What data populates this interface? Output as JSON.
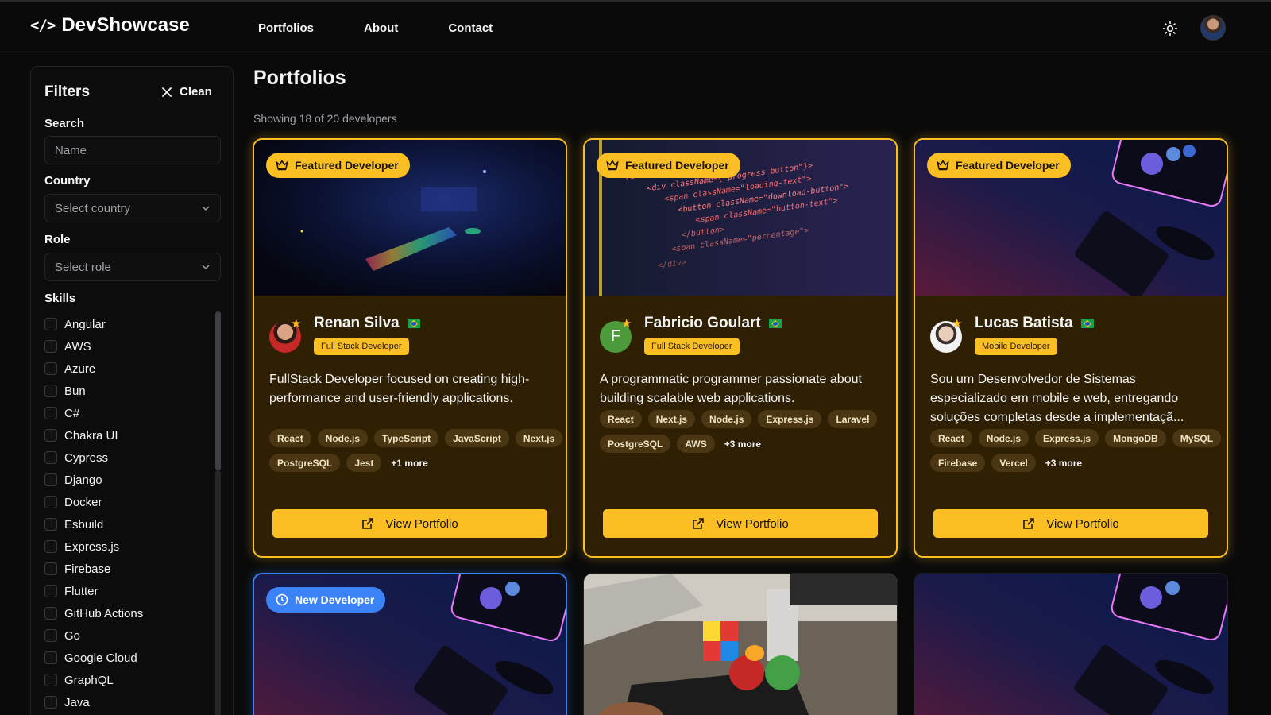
{
  "header": {
    "brand_icon": "</>",
    "brand": "DevShowcase",
    "nav": [
      "Portfolios",
      "About",
      "Contact"
    ],
    "theme_icon": "sun-icon",
    "avatar_icon": "user-avatar"
  },
  "filters": {
    "title": "Filters",
    "clean_label": "Clean",
    "search_label": "Search",
    "search_placeholder": "Name",
    "country_label": "Country",
    "country_value": "Select country",
    "role_label": "Role",
    "role_value": "Select role",
    "skills_label": "Skills",
    "skills": [
      "Angular",
      "AWS",
      "Azure",
      "Bun",
      "C#",
      "Chakra UI",
      "Cypress",
      "Django",
      "Docker",
      "Esbuild",
      "Express.js",
      "Firebase",
      "Flutter",
      "GitHub Actions",
      "Go",
      "Google Cloud",
      "GraphQL",
      "Java"
    ]
  },
  "main": {
    "title": "Portfolios",
    "showing": "Showing 18 of 20 developers",
    "cards": [
      {
        "badge": "Featured Developer",
        "name": "Renan Silva",
        "role": "Full Stack Developer",
        "description": "FullStack Developer focused on creating high-performance and user-friendly applications.",
        "tags": [
          "React",
          "Node.js",
          "TypeScript",
          "JavaScript",
          "Next.js",
          "PostgreSQL",
          "Jest"
        ],
        "more": "+1 more",
        "button": "View Portfolio"
      },
      {
        "badge": "Featured Developer",
        "name": "Fabricio Goulart",
        "initial": "F",
        "role": "Full Stack Developer",
        "description": "A programmatic programmer passionate about building scalable web applications.",
        "tags": [
          "React",
          "Next.js",
          "Node.js",
          "Express.js",
          "Laravel",
          "PostgreSQL",
          "AWS"
        ],
        "more": "+3 more",
        "button": "View Portfolio"
      },
      {
        "badge": "Featured Developer",
        "name": "Lucas Batista",
        "role": "Mobile Developer",
        "description": "Sou um Desenvolvedor de Sistemas especializado em mobile e web, entregando soluções completas desde a implementaçã...",
        "tags": [
          "React",
          "Node.js",
          "Express.js",
          "MongoDB",
          "MySQL",
          "Firebase",
          "Vercel"
        ],
        "more": "+3 more",
        "button": "View Portfolio"
      },
      {
        "badge": "New Developer"
      }
    ]
  },
  "colors": {
    "accent": "#fbbf24",
    "new_badge": "#3b82f6",
    "background": "#0a0a0a"
  }
}
